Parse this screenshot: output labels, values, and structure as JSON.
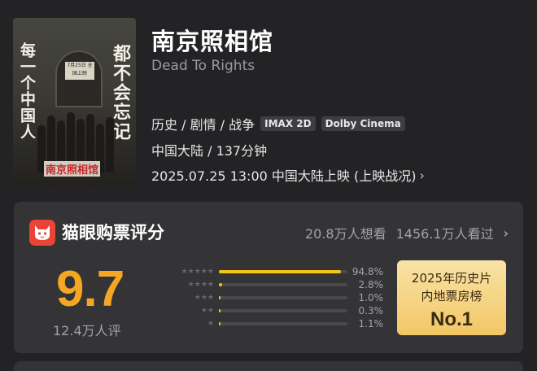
{
  "movie": {
    "title": "南京照相馆",
    "english_title": "Dead To Rights",
    "genres": "历史 / 剧情 / 战争",
    "formats": [
      "IMAX 2D",
      "Dolby Cinema"
    ],
    "region_runtime": "中国大陆 / 137分钟",
    "release": "2025.07.25 13:00 中国大陆上映 (上映战况)"
  },
  "poster": {
    "left_text": "每一个中国人",
    "right_text": "都不会忘记",
    "sign_text": "7月25日 全国上映",
    "title_text": "南京照相馆"
  },
  "rating": {
    "card_title": "猫眼购票评分",
    "want_to_see": "20.8万人想看",
    "have_seen": "1456.1万人看过",
    "score": "9.7",
    "rating_count": "12.4万人评",
    "distribution": [
      {
        "stars": 5,
        "stars_text": "★★★★★",
        "percent": 94.8,
        "label": "94.8%"
      },
      {
        "stars": 4,
        "stars_text": "★★★★",
        "percent": 2.8,
        "label": "2.8%"
      },
      {
        "stars": 3,
        "stars_text": "★★★",
        "percent": 1.0,
        "label": "1.0%"
      },
      {
        "stars": 2,
        "stars_text": "★★",
        "percent": 0.3,
        "label": "0.3%"
      },
      {
        "stars": 1,
        "stars_text": "★",
        "percent": 1.1,
        "label": "1.1%"
      }
    ],
    "rank_badge": {
      "line1": "2025年历史片",
      "line2": "内地票房榜",
      "line3": "No.1"
    }
  },
  "colors": {
    "background": "#232325",
    "card": "#343437",
    "score": "#f5a623",
    "bar": "#f5c518",
    "logo": "#e94435"
  },
  "icons": {
    "chevron": "chevron-right-icon",
    "logo": "maoyan-cat-logo-icon"
  }
}
